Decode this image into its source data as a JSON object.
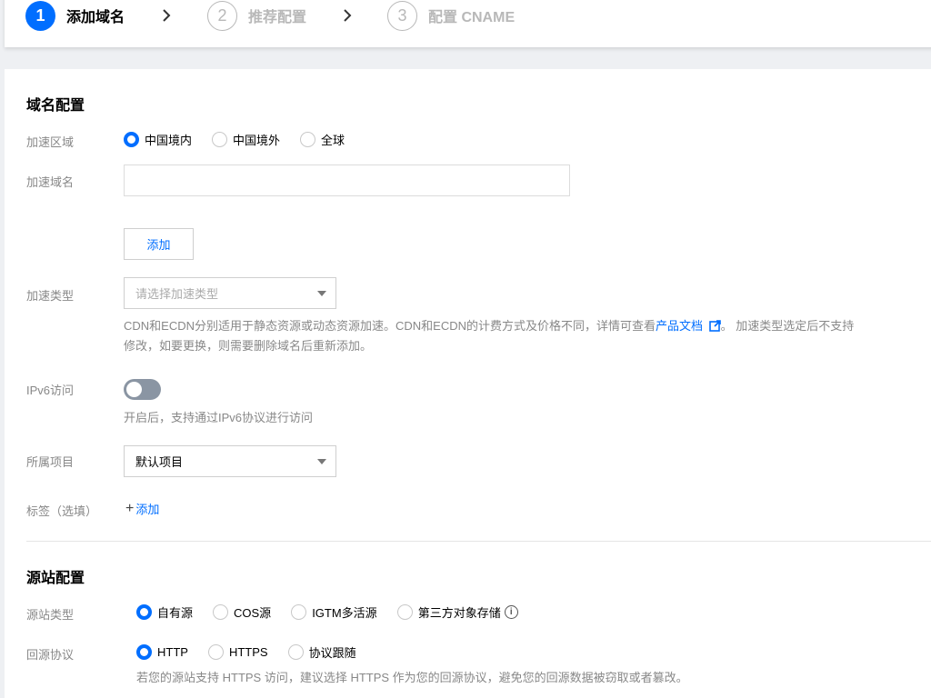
{
  "steps": [
    {
      "num": "1",
      "label": "添加域名"
    },
    {
      "num": "2",
      "label": "推荐配置"
    },
    {
      "num": "3",
      "label": "配置 CNAME"
    }
  ],
  "domain_config": {
    "title": "域名配置",
    "region": {
      "label": "加速区域",
      "options": [
        "中国境内",
        "中国境外",
        "全球"
      ],
      "selected": "中国境内"
    },
    "domain": {
      "label": "加速域名",
      "value": ""
    },
    "add_button": "添加",
    "type": {
      "label": "加速类型",
      "placeholder": "请选择加速类型",
      "help_1": "CDN和ECDN分别适用于静态资源或动态资源加速。CDN和ECDN的计费方式及价格不同，详情可查看",
      "help_link": "产品文档",
      "help_2": "。 加速类型选定后不支持",
      "help_3": "修改，如要更换，则需要删除域名后重新添加。"
    },
    "ipv6": {
      "label": "IPv6访问",
      "enabled": false,
      "help": "开启后，支持通过IPv6协议进行访问"
    },
    "project": {
      "label": "所属项目",
      "value": "默认项目"
    },
    "tags": {
      "label": "标签（选填）",
      "add": "添加"
    }
  },
  "origin_config": {
    "title": "源站配置",
    "origin_type": {
      "label": "源站类型",
      "options": [
        "自有源",
        "COS源",
        "IGTM多活源",
        "第三方对象存储"
      ],
      "selected": "自有源"
    },
    "protocol": {
      "label": "回源协议",
      "options": [
        "HTTP",
        "HTTPS",
        "协议跟随"
      ],
      "selected": "HTTP",
      "help": "若您的源站支持 HTTPS 访问，建议选择 HTTPS 作为您的回源协议，避免您的回源数据被窃取或者篡改。"
    }
  },
  "colors": {
    "accent": "#006eff",
    "toggle_off": "#8a95a3"
  }
}
